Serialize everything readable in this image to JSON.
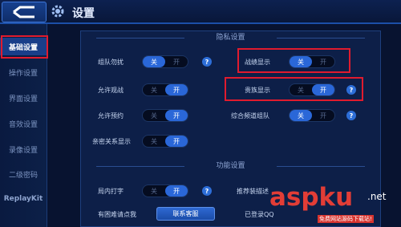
{
  "header": {
    "title": "设置"
  },
  "sidebar": {
    "items": [
      {
        "label": "基础设置",
        "active": true
      },
      {
        "label": "操作设置"
      },
      {
        "label": "界面设置"
      },
      {
        "label": "音效设置"
      },
      {
        "label": "录像设置"
      },
      {
        "label": "二级密码"
      },
      {
        "label": "ReplayKit"
      }
    ]
  },
  "privacy": {
    "heading": "隐私设置",
    "rows": [
      {
        "label": "组队勿扰",
        "off": "关",
        "on": "开",
        "state": "关",
        "help": "?"
      },
      {
        "label": "战绩显示",
        "off": "关",
        "on": "开",
        "state": "关"
      },
      {
        "label": "允许观战",
        "off": "关",
        "on": "开",
        "state": "开"
      },
      {
        "label": "贵族显示",
        "off": "关",
        "on": "开",
        "state": "开",
        "help": "?"
      },
      {
        "label": "允许预约",
        "off": "关",
        "on": "开",
        "state": "开"
      },
      {
        "label": "综合频道组队",
        "off": "关",
        "on": "开",
        "state": "关",
        "help": "?"
      },
      {
        "label": "亲密关系显示",
        "off": "关",
        "on": "开",
        "state": "开"
      }
    ]
  },
  "function": {
    "heading": "功能设置",
    "rows": [
      {
        "label": "局内打字",
        "off": "关",
        "on": "开",
        "state": "开",
        "help": "?"
      },
      {
        "label": "推荐装描述"
      },
      {
        "label": "有困难请点我",
        "button": "联系客服"
      },
      {
        "label": "已登录QQ"
      }
    ]
  },
  "watermark": {
    "text": "aspku",
    "suffix": ".net",
    "subtitle": "免费网站源码下载站!"
  }
}
